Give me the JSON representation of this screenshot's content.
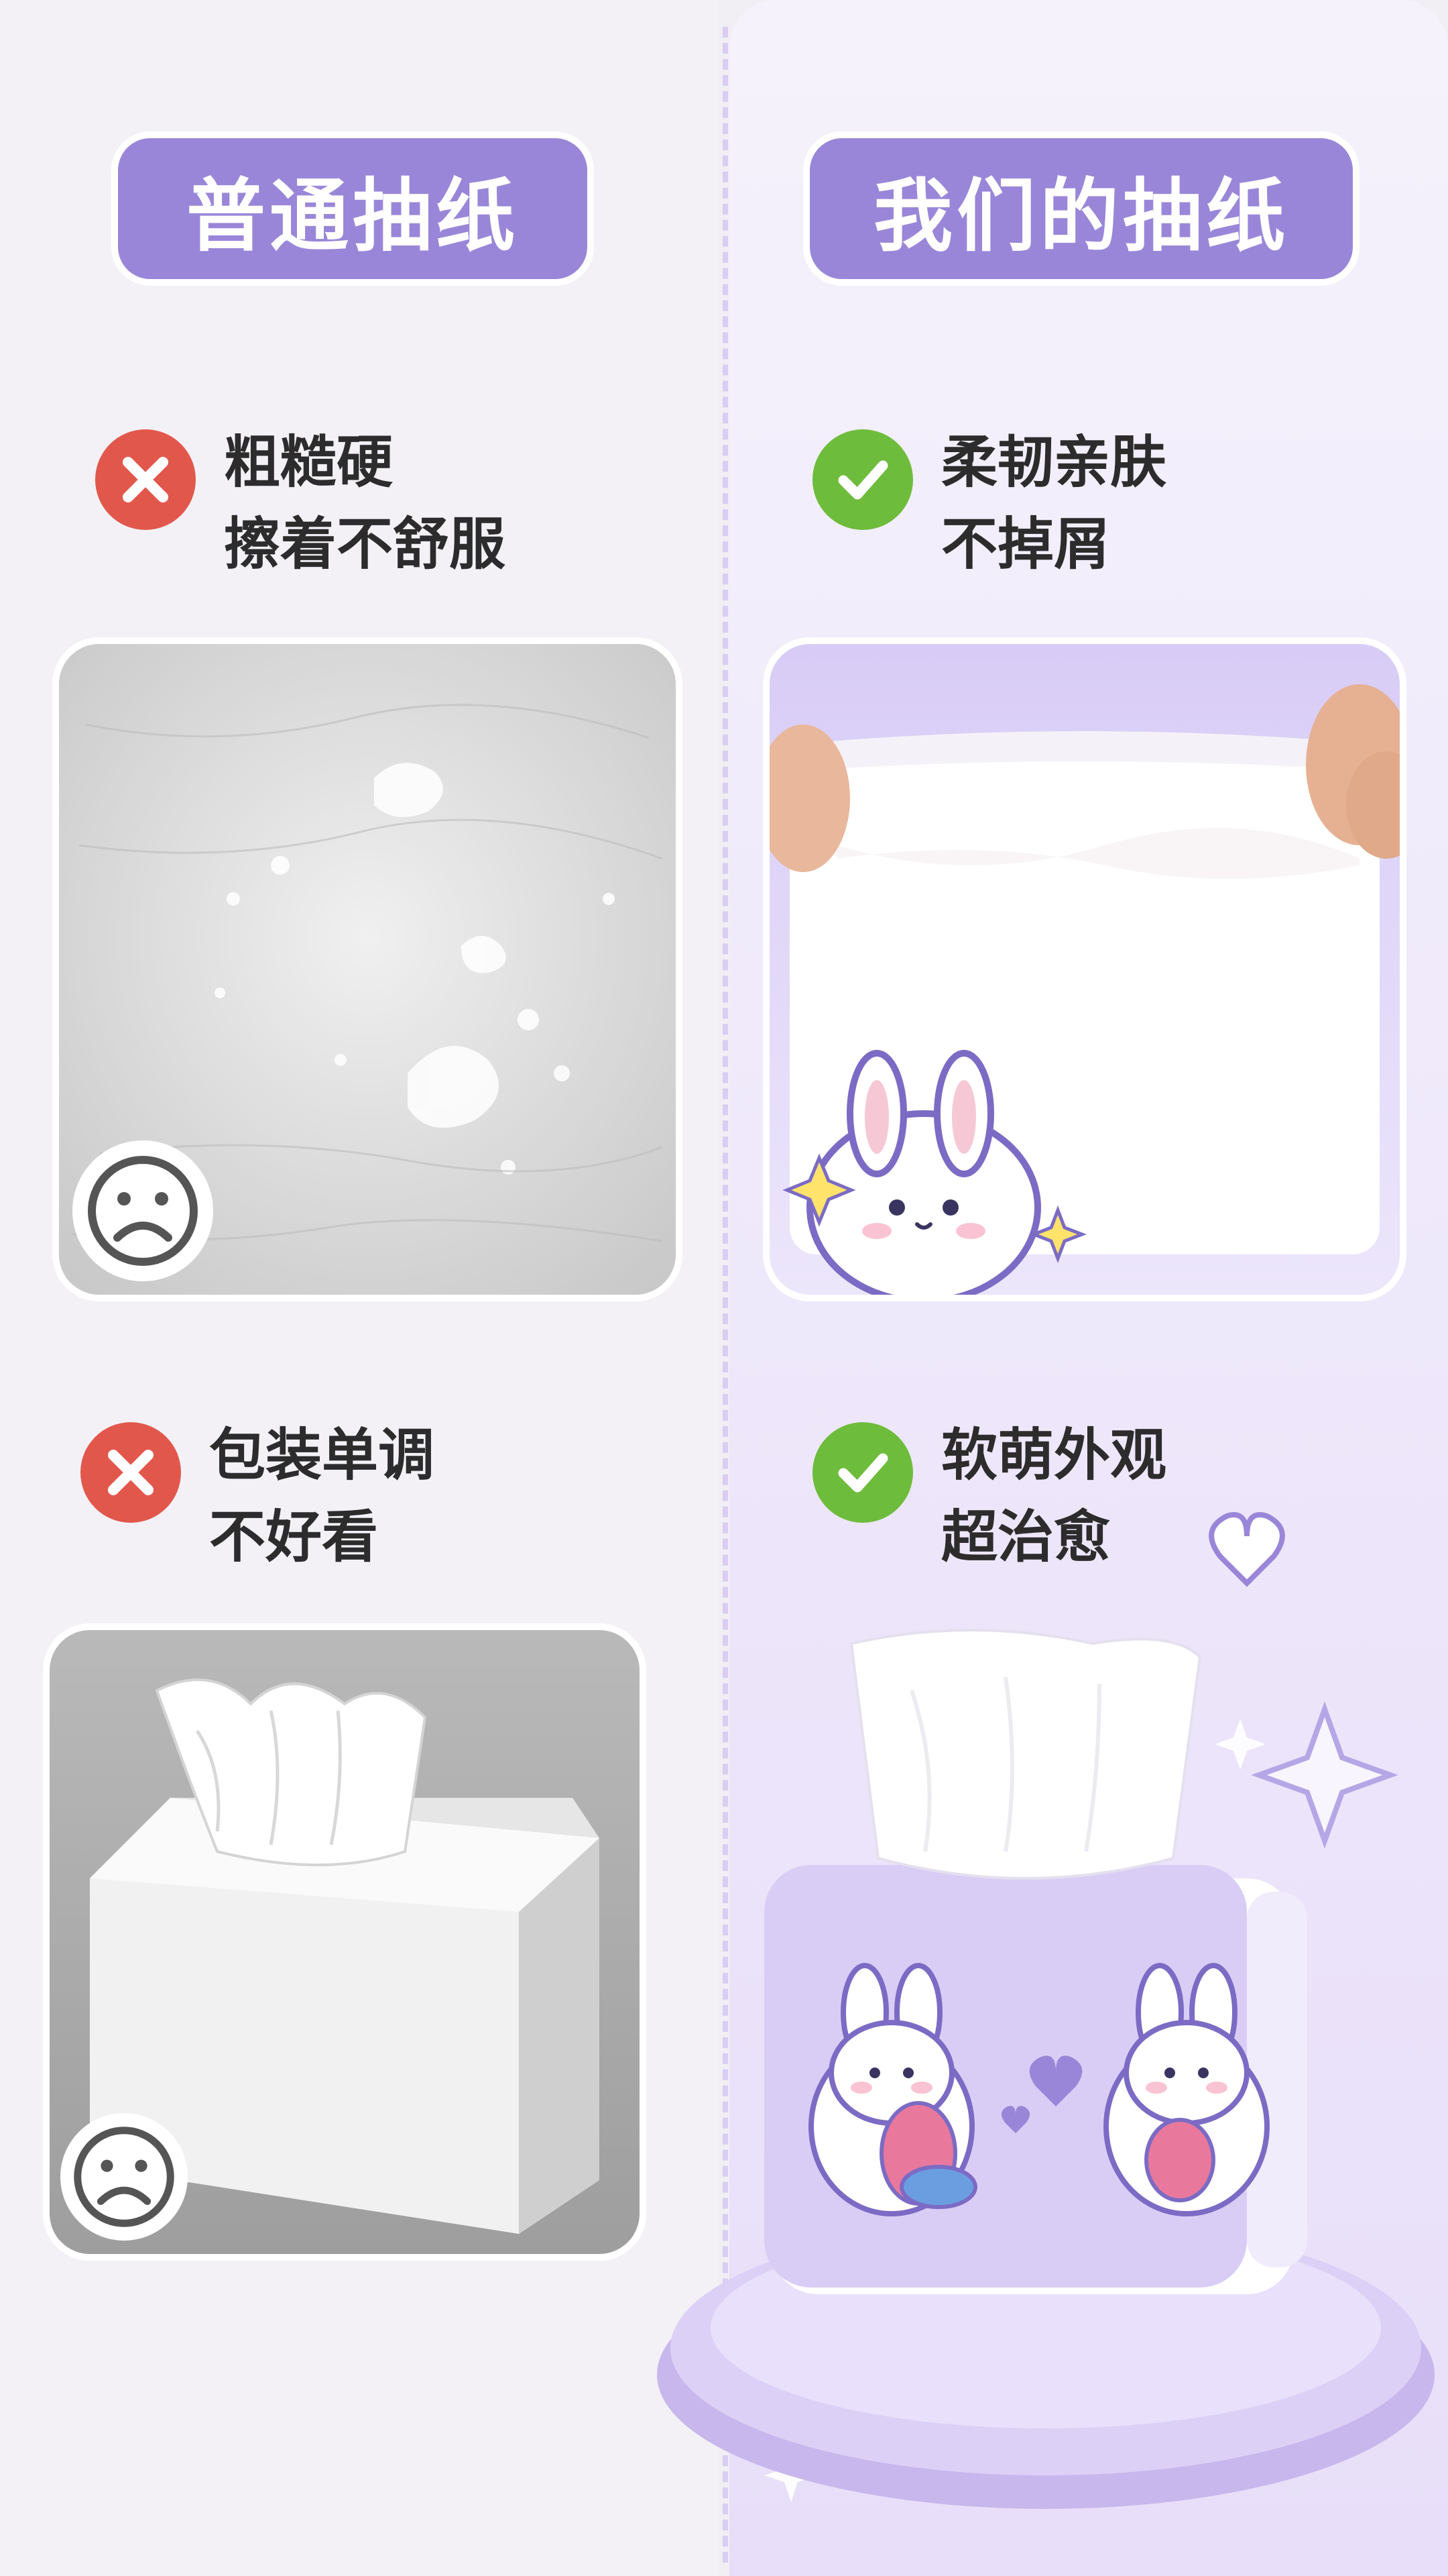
{
  "left": {
    "title": "普通抽纸",
    "claim1": {
      "line1": "粗糙硬",
      "line2": "擦着不舒服"
    },
    "claim2": {
      "line1": "包装单调",
      "line2": "不好看"
    }
  },
  "right": {
    "title": "我们的抽纸",
    "claim1": {
      "line1": "柔韧亲肤",
      "line2": "不掉屑"
    },
    "claim2": {
      "line1": "软萌外观",
      "line2": "超治愈"
    }
  },
  "icons": {
    "bad": "cross-icon",
    "good": "check-icon",
    "sad": "sad-face-icon"
  },
  "colors": {
    "accent": "#9a86d8",
    "bad": "#e2574c",
    "good": "#6ebc3c",
    "text": "#2c2c2c"
  }
}
